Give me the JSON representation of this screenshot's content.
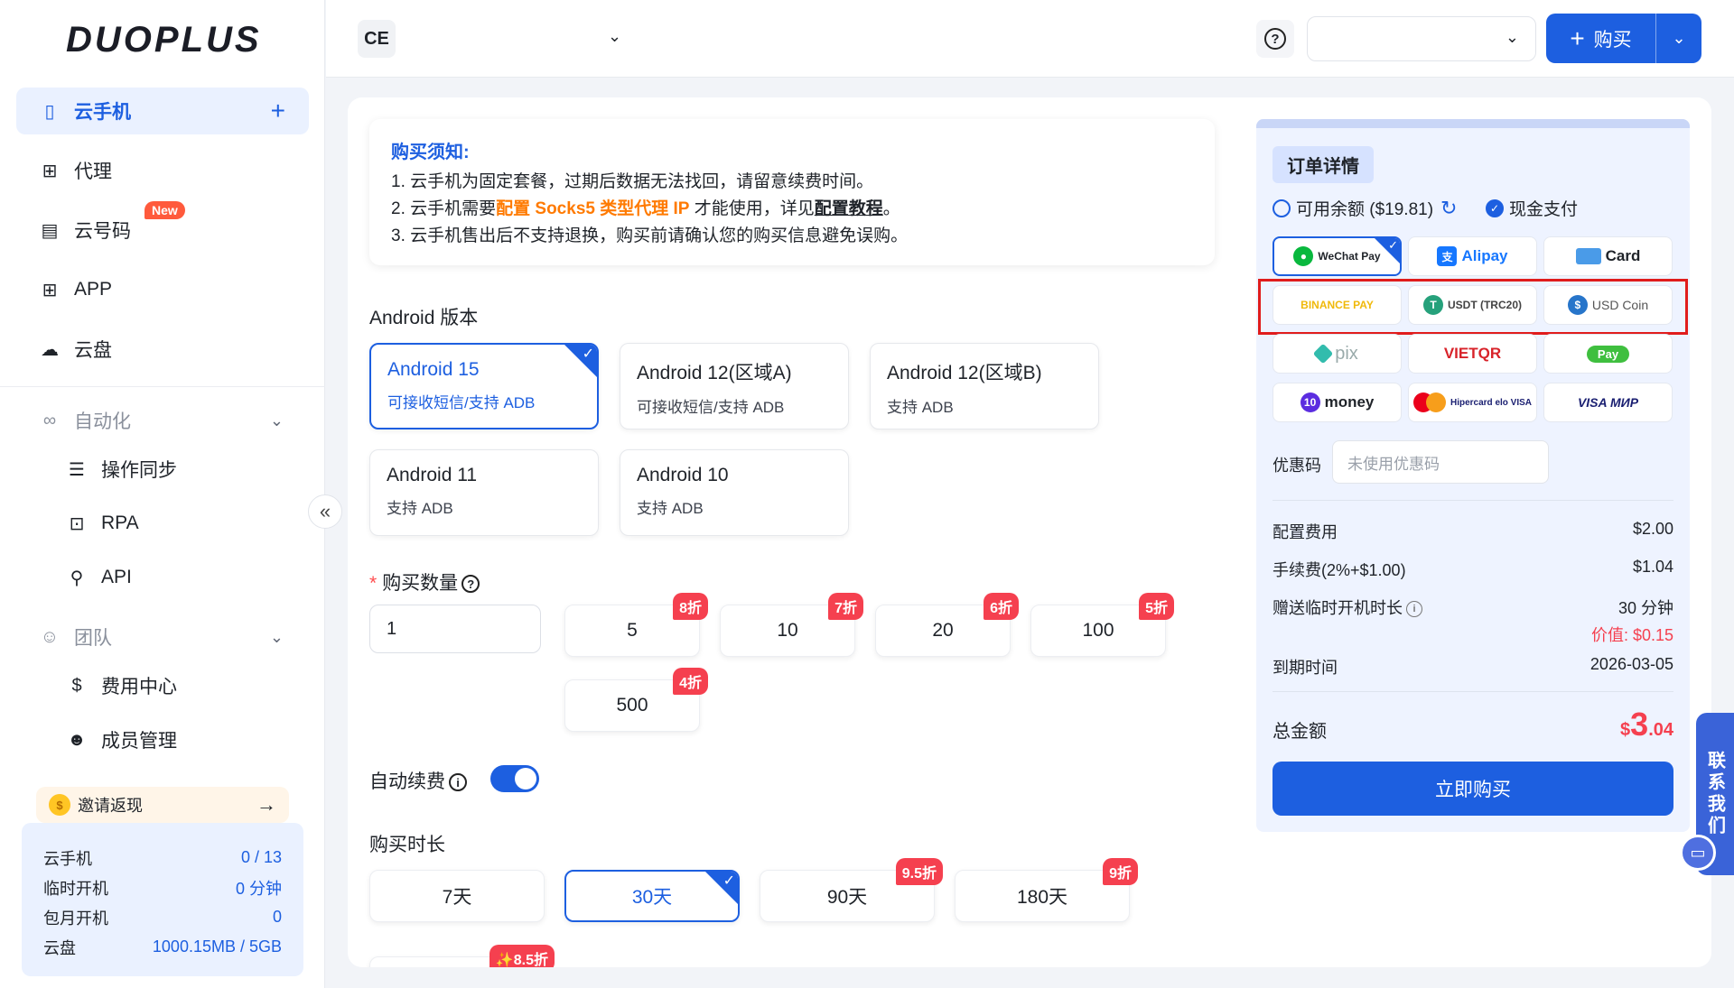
{
  "brand": {
    "logo": "DUOPLUS"
  },
  "sidebar": {
    "items": [
      {
        "label": "云手机",
        "icon": "phone-icon"
      },
      {
        "label": "代理",
        "icon": "network-icon"
      },
      {
        "label": "云号码",
        "icon": "sim-icon",
        "badge": "New"
      },
      {
        "label": "APP",
        "icon": "apps-grid-icon"
      },
      {
        "label": "云盘",
        "icon": "cloud-icon"
      }
    ],
    "automation": {
      "label": "自动化",
      "children": [
        "操作同步",
        "RPA",
        "API"
      ]
    },
    "team": {
      "label": "团队",
      "children": [
        "费用中心",
        "成员管理"
      ]
    },
    "invite": "邀请返现",
    "stats": [
      {
        "label": "云手机",
        "value": "0 / 13"
      },
      {
        "label": "临时开机",
        "value": "0 分钟"
      },
      {
        "label": "包月开机",
        "value": "0"
      },
      {
        "label": "云盘",
        "value": "1000.15MB / 5GB"
      }
    ]
  },
  "header": {
    "workspace": "CE",
    "buy_label": "购买"
  },
  "notice": {
    "title": "购买须知:",
    "line1": "1. 云手机为固定套餐，过期后数据无法找回，请留意续费时间。",
    "line2_a": "2. 云手机需要",
    "line2_hl": "配置 Socks5 类型代理 IP",
    "line2_b": " 才能使用，详见",
    "line2_link": "配置教程",
    "line2_c": "。",
    "line3": "3. 云手机售出后不支持退换，购买前请确认您的购买信息避免误购。"
  },
  "android": {
    "title": "Android 版本",
    "versions": [
      {
        "name": "Android 15",
        "desc": "可接收短信/支持 ADB",
        "selected": true
      },
      {
        "name": "Android 12(区域A)",
        "desc": "可接收短信/支持 ADB",
        "selected": false
      },
      {
        "name": "Android 12(区域B)",
        "desc": "支持 ADB",
        "selected": false
      },
      {
        "name": "Android 11",
        "desc": "支持 ADB",
        "selected": false
      },
      {
        "name": "Android 10",
        "desc": "支持 ADB",
        "selected": false
      }
    ]
  },
  "quantity": {
    "title": "购买数量",
    "value": "1",
    "options": [
      {
        "value": "5",
        "discount": "8折"
      },
      {
        "value": "10",
        "discount": "7折"
      },
      {
        "value": "20",
        "discount": "6折"
      },
      {
        "value": "100",
        "discount": "5折"
      },
      {
        "value": "500",
        "discount": "4折"
      }
    ]
  },
  "auto_renew": {
    "label": "自动续费",
    "enabled": true
  },
  "duration": {
    "title": "购买时长",
    "options": [
      {
        "label": "7天",
        "discount": "",
        "selected": false
      },
      {
        "label": "30天",
        "discount": "",
        "selected": true
      },
      {
        "label": "90天",
        "discount": "9.5折",
        "selected": false
      },
      {
        "label": "180天",
        "discount": "9折",
        "selected": false
      }
    ],
    "extra_discount": "✨8.5折"
  },
  "order": {
    "title": "订单详情",
    "balance_label": "可用余额 ($19.81)",
    "cash_label": "现金支付",
    "payment_methods": [
      "WeChat Pay",
      "Alipay",
      "Card",
      "BINANCE PAY",
      "USDT (TRC20)",
      "USD Coin",
      "pix",
      "VIETQR",
      "Pay",
      "money",
      "Hipercard elo VISA",
      "VISA МИР"
    ],
    "promo_label": "优惠码",
    "promo_placeholder": "未使用优惠码",
    "fees": [
      {
        "label": "配置费用",
        "value": "$2.00"
      },
      {
        "label": "手续费(2%+$1.00)",
        "value": "$1.04"
      },
      {
        "label": "赠送临时开机时长",
        "value": "30 分钟",
        "sub": "价值: $0.15"
      },
      {
        "label": "到期时间",
        "value": "2026-03-05"
      }
    ],
    "total_label": "总金额",
    "total_currency": "$",
    "total_int": "3",
    "total_dec": ".04",
    "checkout": "立即购买"
  },
  "contact": "联系我们",
  "colors": {
    "primary": "#1d5fe0",
    "discount": "#f5404f",
    "highlight": "#ff7a00"
  }
}
